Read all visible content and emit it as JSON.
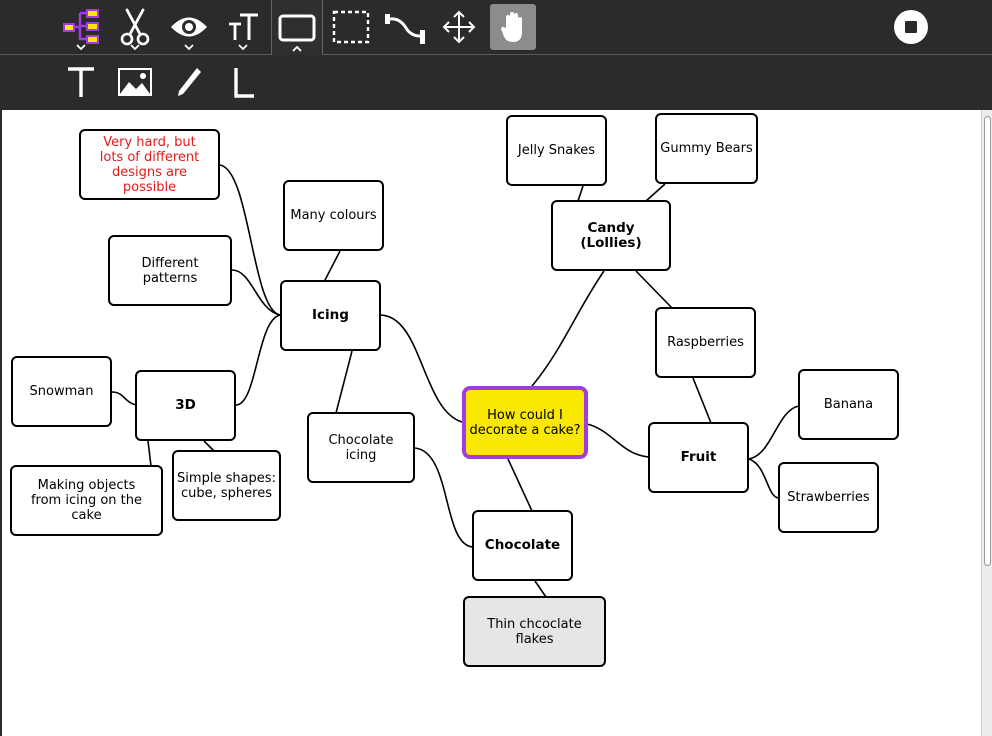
{
  "toolbar": {
    "tools": [
      {
        "name": "mindmap-tool",
        "icon": "mindmap-icon"
      },
      {
        "name": "cut-tool",
        "icon": "scissors-icon"
      },
      {
        "name": "view-tool",
        "icon": "eye-icon"
      },
      {
        "name": "text-size-tool",
        "icon": "text-size-icon"
      },
      {
        "name": "frame-tool",
        "icon": "frame-icon",
        "active": true
      },
      {
        "name": "select-tool",
        "icon": "dashed-select-icon"
      },
      {
        "name": "connector-tool",
        "icon": "connector-icon"
      },
      {
        "name": "move-tool",
        "icon": "move-arrows-icon"
      },
      {
        "name": "hand-tool",
        "icon": "hand-icon",
        "active": true
      }
    ],
    "stop_icon": "stop-icon"
  },
  "insert_toolbar": {
    "tools": [
      {
        "name": "insert-text-tool",
        "icon": "text-icon"
      },
      {
        "name": "insert-image-tool",
        "icon": "image-icon"
      },
      {
        "name": "pen-tool",
        "icon": "pen-icon"
      },
      {
        "name": "line-tool",
        "icon": "line-icon"
      }
    ]
  },
  "colors": {
    "toolbar_bg": "#2b2b2b",
    "accent_mindmap": "#a13de0",
    "mindmap_fill": "#fbe800",
    "center_fill": "#fbe800",
    "center_border": "#a13de0",
    "red_text": "#e01b1b",
    "gray_node": "#e6e6e6"
  },
  "mindmap": {
    "center": "How could I\ndecorate a cake?",
    "nodes": {
      "icing": "Icing",
      "many_colours": "Many colours",
      "very_hard": "Very hard, but\nlots of different\ndesigns are possible",
      "different_patterns": "Different patterns",
      "three_d": "3D",
      "snowman": "Snowman",
      "making_objects": "Making objects\nfrom icing on the cake",
      "simple_shapes": "Simple shapes:\ncube, spheres",
      "chocolate_icing": "Chocolate icing",
      "chocolate": "Chocolate",
      "thin_flakes": "Thin chcoclate flakes",
      "candy": "Candy (Lollies)",
      "jelly_snakes": "Jelly Snakes",
      "gummy_bears": "Gummy Bears",
      "raspberries": "Raspberries",
      "fruit": "Fruit",
      "banana": "Banana",
      "strawberries": "Strawberries"
    }
  }
}
